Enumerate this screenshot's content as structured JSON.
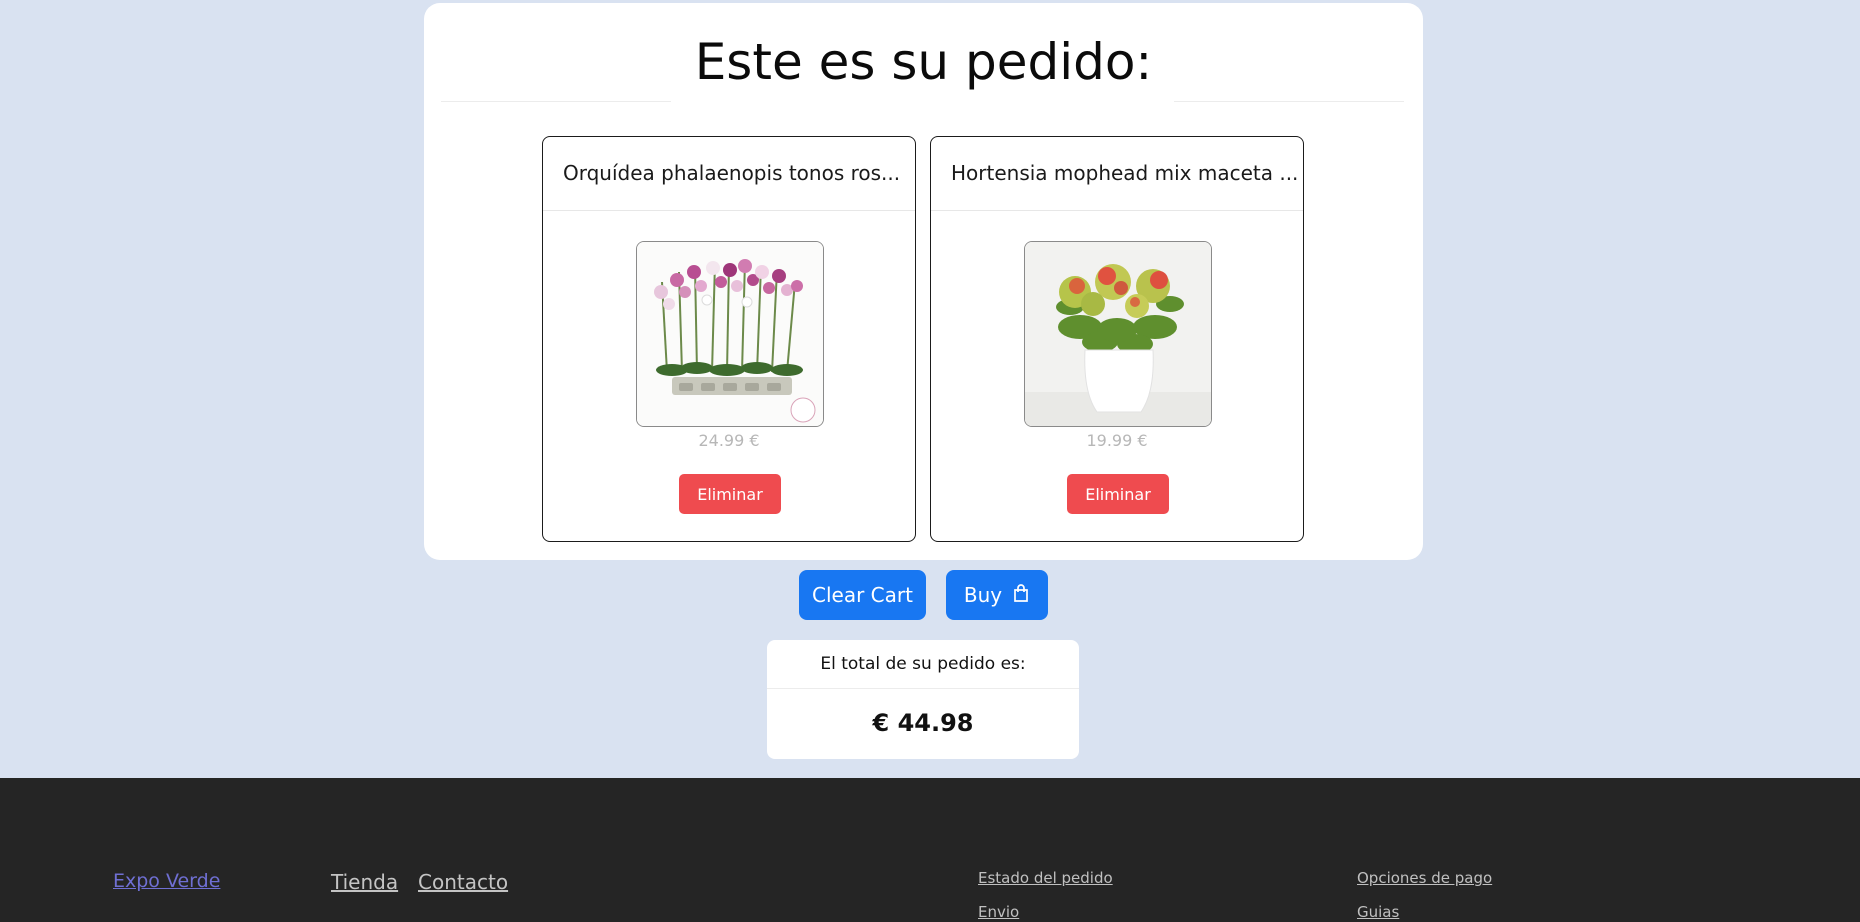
{
  "page": {
    "title": "Este es su pedido:"
  },
  "products": [
    {
      "name": "Orquídea phalaenopis tonos ros...",
      "price": "24.99 €",
      "remove_label": "Eliminar",
      "image": "orchid-plant-image"
    },
    {
      "name": "Hortensia mophead mix maceta ...",
      "price": "19.99 €",
      "remove_label": "Eliminar",
      "image": "hydrangea-plant-image"
    }
  ],
  "actions": {
    "clear_label": "Clear Cart",
    "buy_label": "Buy",
    "buy_icon": "shopping-bag-icon"
  },
  "total": {
    "label": "El total de su pedido es:",
    "value": "€ 44.98"
  },
  "footer": {
    "brand": "Expo Verde",
    "nav": [
      "Tienda",
      "Contacto"
    ],
    "column1": [
      "Estado del pedido",
      "Envio"
    ],
    "column2": [
      "Opciones de pago",
      "Guias"
    ]
  },
  "colors": {
    "background": "#d9e2f1",
    "primary": "#1877f2",
    "danger": "#ef4b4f",
    "footer": "#252525"
  }
}
